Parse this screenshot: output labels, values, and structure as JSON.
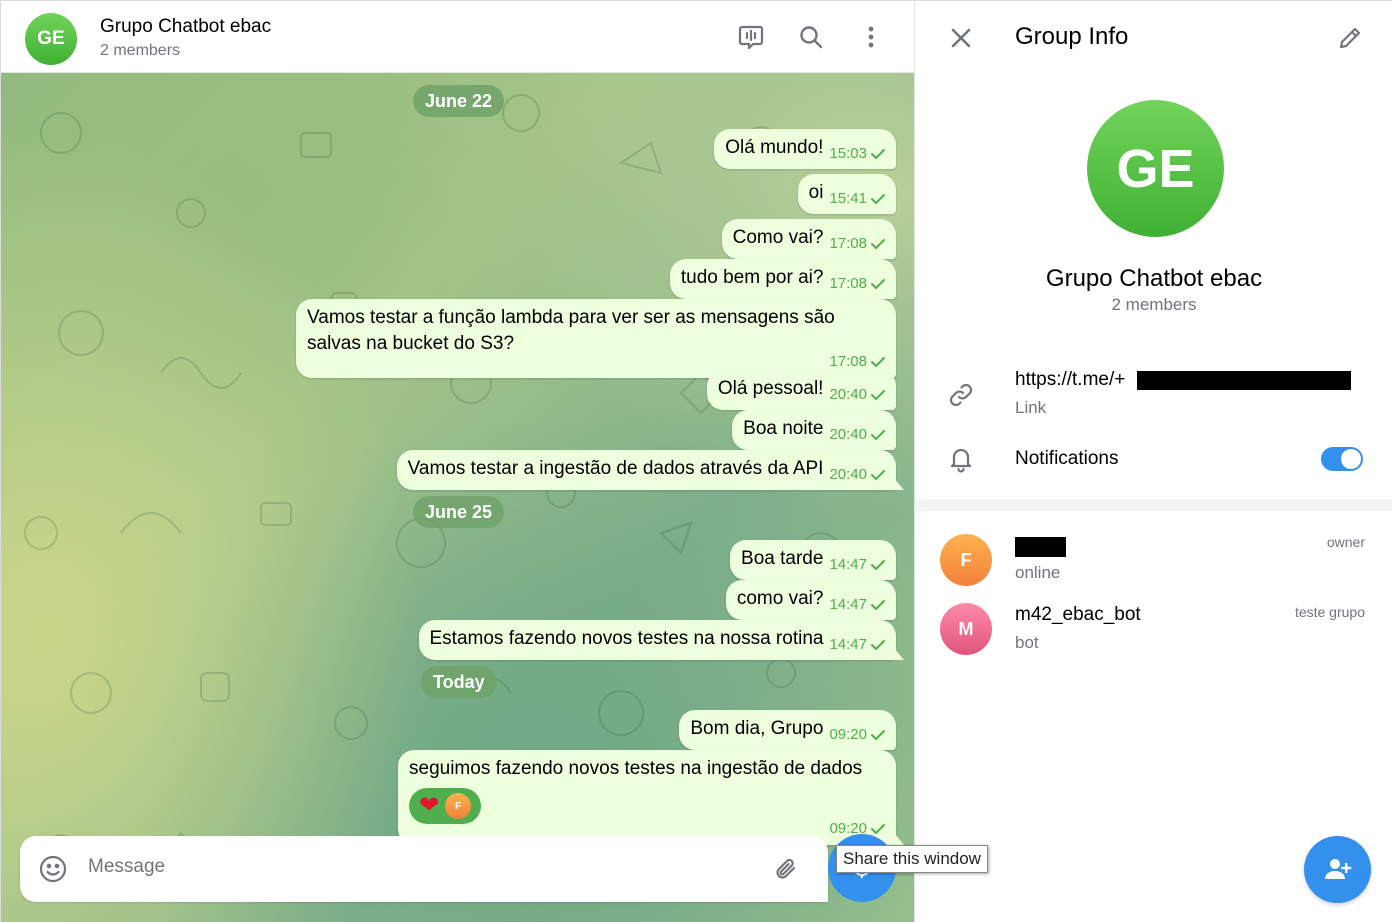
{
  "chat": {
    "avatar_initials": "GE",
    "title": "Grupo Chatbot ebac",
    "subtitle": "2 members"
  },
  "icons": {
    "voice_chat": "voice-chat-icon",
    "search": "search-icon",
    "more": "more-vertical-icon",
    "emoji": "emoji-icon",
    "attach": "paperclip-icon",
    "close": "close-icon",
    "edit": "pencil-icon",
    "link": "link-icon",
    "bell": "bell-icon",
    "add_member": "add-user-icon"
  },
  "dates": {
    "d1": "June 22",
    "d2": "June 25",
    "d3": "Today"
  },
  "messages": [
    {
      "text": "Olá mundo!",
      "time": "15:03"
    },
    {
      "text": "oi",
      "time": "15:41"
    },
    {
      "text": "Como vai?",
      "time": "17:08"
    },
    {
      "text": "tudo bem por ai?",
      "time": "17:08"
    },
    {
      "text_line1": "Vamos testar a função lambda para ver ser as mensagens são",
      "text_line2": "salvas na bucket do S3?",
      "time": "17:08"
    },
    {
      "text": "Olá pessoal!",
      "time": "20:40"
    },
    {
      "text": "Boa noite",
      "time": "20:40"
    },
    {
      "text": "Vamos testar a ingestão de dados através da API",
      "time": "20:40"
    },
    {
      "text": "Boa tarde",
      "time": "14:47"
    },
    {
      "text": "como vai?",
      "time": "14:47"
    },
    {
      "text": "Estamos fazendo novos testes na nossa rotina",
      "time": "14:47"
    },
    {
      "text": "Bom dia, Grupo",
      "time": "09:20"
    },
    {
      "text": "seguimos fazendo novos testes na ingestão de dados",
      "time": "09:20",
      "reaction": "❤",
      "reactor_initial": "F"
    }
  ],
  "composer": {
    "placeholder": "Message"
  },
  "tooltip": "Share this window",
  "info": {
    "title": "Group Info",
    "avatar_initials": "GE",
    "name": "Grupo Chatbot ebac",
    "members": "2 members",
    "link": "https://t.me/+",
    "link_label": "Link",
    "notifications_label": "Notifications",
    "notifications_on": true
  },
  "members": [
    {
      "initial": "F",
      "name": "",
      "status": "online",
      "role": "owner"
    },
    {
      "initial": "M",
      "name": "m42_ebac_bot",
      "status": "bot",
      "role": "teste grupo"
    }
  ],
  "colors": {
    "accent": "#3390ec",
    "bubble": "#eeffde",
    "check": "#4fae4e",
    "avatar_green": "#4fbe3c",
    "avatar_orange": "#f5923e",
    "avatar_pink": "#e8668a"
  }
}
